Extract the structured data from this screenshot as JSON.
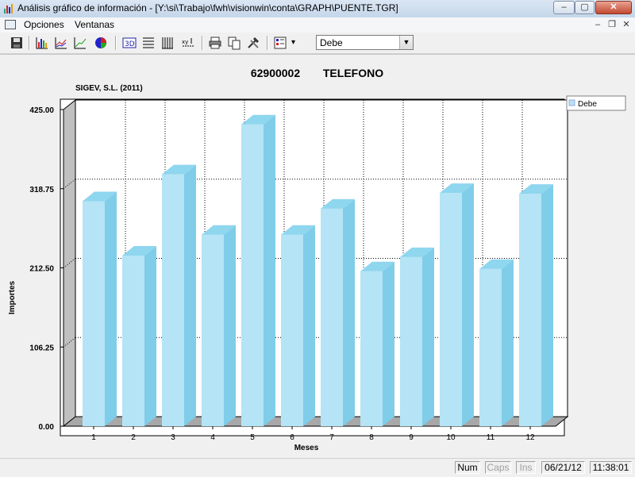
{
  "window": {
    "title": "Análisis gráfico de información - [Y:\\si\\Trabajo\\fwh\\visionwin\\conta\\GRAPH\\PUENTE.TGR]",
    "min_label": "–",
    "max_label": "▢",
    "close_label": "✕"
  },
  "menu": {
    "items": [
      "Opciones",
      "Ventanas"
    ],
    "mdi_min": "–",
    "mdi_restore": "❐",
    "mdi_close": "✕"
  },
  "toolbar": {
    "icons": [
      "save-icon",
      "bar-chart-icon",
      "line-chart-icon",
      "trend-chart-icon",
      "pie-chart-icon",
      "3d-toggle-icon",
      "horizontal-grid-icon",
      "vertical-grid-icon",
      "axis-scale-icon",
      "print-icon",
      "copy-icon",
      "tools-icon",
      "legend-icon"
    ],
    "combo_value": "Debe",
    "combo_arrow": "▼",
    "legend_arrow": "▾"
  },
  "chart_data": {
    "type": "bar",
    "title_code": "62900002",
    "title_name": "TELEFONO",
    "subtitle": "SIGEV, S.L. (2011)",
    "xlabel": "Meses",
    "ylabel": "Importes",
    "categories": [
      "1",
      "2",
      "3",
      "4",
      "5",
      "6",
      "7",
      "8",
      "9",
      "10",
      "11",
      "12"
    ],
    "series": [
      {
        "name": "Debe",
        "values": [
          302,
          229,
          338,
          257,
          405,
          257,
          292,
          208,
          227,
          313,
          211,
          312
        ]
      }
    ],
    "ylim": [
      0,
      425
    ],
    "yticks": [
      "0.00",
      "106.25",
      "212.50",
      "318.75",
      "425.00"
    ],
    "grid": true,
    "three_d": true,
    "legend_position": "right",
    "bar_color": "#b4e4f5",
    "bar_side_color": "#7fcde9",
    "bar_top_color": "#8fd6ef"
  },
  "status": {
    "num": "Num",
    "caps": "Caps",
    "ins": "Ins",
    "date": "06/21/12",
    "time": "11:38:01"
  }
}
